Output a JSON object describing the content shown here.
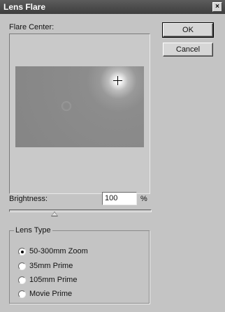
{
  "window": {
    "title": "Lens Flare",
    "close_glyph": "×"
  },
  "preview": {
    "label": "Flare Center:"
  },
  "buttons": {
    "ok": "OK",
    "cancel": "Cancel"
  },
  "brightness": {
    "label": "Brightness:",
    "value": "100",
    "unit": "%",
    "slider_fraction": 0.32
  },
  "lens_type": {
    "legend": "Lens Type",
    "options": [
      {
        "label": "50-300mm Zoom",
        "selected": true
      },
      {
        "label": "35mm Prime",
        "selected": false
      },
      {
        "label": "105mm Prime",
        "selected": false
      },
      {
        "label": "Movie Prime",
        "selected": false
      }
    ]
  }
}
